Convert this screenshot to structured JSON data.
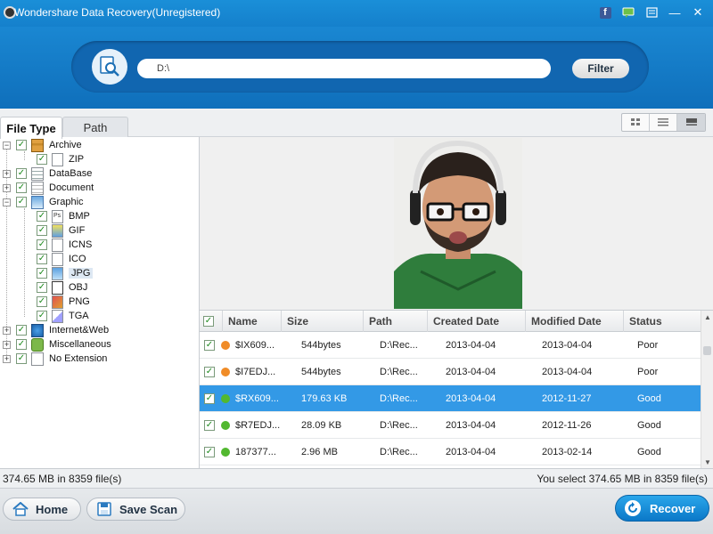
{
  "window": {
    "title": "Wondershare Data Recovery(Unregistered)",
    "icons": [
      "facebook-icon",
      "feedback-icon",
      "register-icon",
      "minimize-icon",
      "close-icon"
    ],
    "facebook_glyph": "f",
    "minimize_glyph": "—",
    "close_glyph": "✕"
  },
  "search": {
    "path_value": "D:\\",
    "filter_label": "Filter"
  },
  "tabs": {
    "file_type": "File Type",
    "path": "Path"
  },
  "tree": {
    "archive": "Archive",
    "zip": "ZIP",
    "database": "DataBase",
    "document": "Document",
    "graphic": "Graphic",
    "bmp": "BMP",
    "gif": "GIF",
    "icns": "ICNS",
    "ico": "ICO",
    "jpg": "JPG",
    "obj": "OBJ",
    "png": "PNG",
    "tga": "TGA",
    "internet_web": "Internet&Web",
    "miscellaneous": "Miscellaneous",
    "no_extension": "No Extension",
    "check_glyph": "✓",
    "expand_glyph": "+",
    "collapse_glyph": "−"
  },
  "table": {
    "columns": [
      "Name",
      "Size",
      "Path",
      "Created Date",
      "Modified Date",
      "Status"
    ],
    "rows": [
      {
        "name": "$IX609...",
        "size": "544bytes",
        "path": "D:\\Rec...",
        "created": "2013-04-04",
        "modified": "2013-04-04",
        "status": "Poor",
        "status_color": "#f08c28"
      },
      {
        "name": "$I7EDJ...",
        "size": "544bytes",
        "path": "D:\\Rec...",
        "created": "2013-04-04",
        "modified": "2013-04-04",
        "status": "Poor",
        "status_color": "#f08c28"
      },
      {
        "name": "$RX609...",
        "size": "179.63 KB",
        "path": "D:\\Rec...",
        "created": "2013-04-04",
        "modified": "2012-11-27",
        "status": "Good",
        "status_color": "#52b830"
      },
      {
        "name": "$R7EDJ...",
        "size": "28.09 KB",
        "path": "D:\\Rec...",
        "created": "2013-04-04",
        "modified": "2012-11-26",
        "status": "Good",
        "status_color": "#52b830"
      },
      {
        "name": "187377...",
        "size": "2.96 MB",
        "path": "D:\\Rec...",
        "created": "2013-04-04",
        "modified": "2013-02-14",
        "status": "Good",
        "status_color": "#52b830"
      }
    ],
    "selected_row": 2
  },
  "status": {
    "left": "374.65 MB in 8359 file(s)",
    "right": "You select 374.65 MB in 8359 file(s)"
  },
  "footer": {
    "home": "Home",
    "save_scan": "Save Scan",
    "recover": "Recover"
  },
  "colors": {
    "accent": "#1580cc",
    "selection": "#3399e6",
    "poor": "#f08c28",
    "good": "#52b830"
  }
}
